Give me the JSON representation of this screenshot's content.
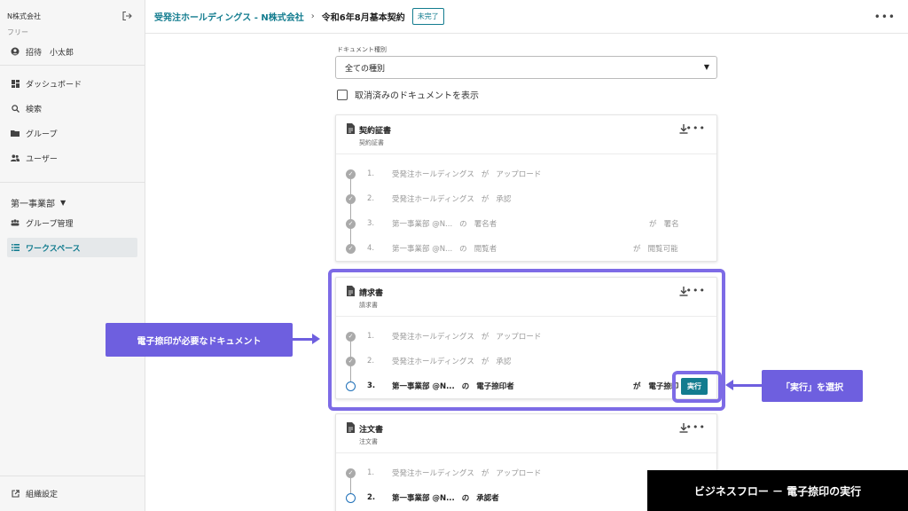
{
  "sidebar": {
    "org_name": "N株式会社",
    "plan": "フリー",
    "user": "招待　小太郎",
    "nav": [
      {
        "label": "ダッシュボード",
        "icon": "dashboard-icon"
      },
      {
        "label": "検索",
        "icon": "search-icon"
      },
      {
        "label": "グループ",
        "icon": "folder-icon"
      },
      {
        "label": "ユーザー",
        "icon": "users-icon"
      }
    ],
    "section": "第一事業部",
    "section_items": [
      {
        "label": "グループ管理",
        "icon": "group-icon"
      },
      {
        "label": "ワークスペース",
        "icon": "list-icon"
      }
    ],
    "settings": "組織設定"
  },
  "header": {
    "breadcrumb_link": "受発注ホールディングス - N株式会社",
    "breadcrumb_sep": "›",
    "current": "令和6年8月基本契約",
    "status": "未完了"
  },
  "filter": {
    "label": "ドキュメント種別",
    "value": "全ての種別",
    "checkbox_label": "取消済みのドキュメントを表示"
  },
  "cards": [
    {
      "title": "契約証書",
      "subtitle": "契約証書",
      "steps": [
        {
          "num": "1.",
          "actor": "受発注ホールディングス",
          "particle": "が",
          "action": "アップロード"
        },
        {
          "num": "2.",
          "actor": "受発注ホールディングス",
          "particle": "が",
          "action": "承認"
        },
        {
          "num": "3.",
          "actor": "第一事業部 @N...",
          "particle": "の",
          "action": "署名者",
          "rparticle": "が",
          "raction": "署名"
        },
        {
          "num": "4.",
          "actor": "第一事業部 @N...",
          "particle": "の",
          "action": "閲覧者",
          "rparticle": "が",
          "raction": "閲覧可能"
        }
      ]
    },
    {
      "title": "請求書",
      "subtitle": "請求書",
      "steps": [
        {
          "num": "1.",
          "actor": "受発注ホールディングス",
          "particle": "が",
          "action": "アップロード"
        },
        {
          "num": "2.",
          "actor": "受発注ホールディングス",
          "particle": "が",
          "action": "承認"
        },
        {
          "num": "3.",
          "actor": "第一事業部 @N...",
          "particle": "の",
          "action": "電子捺印者",
          "rparticle": "が",
          "raction": "電子捺印"
        }
      ],
      "exec_button": "実行"
    },
    {
      "title": "注文書",
      "subtitle": "注文書",
      "steps": [
        {
          "num": "1.",
          "actor": "受発注ホールディングス",
          "particle": "が",
          "action": "アップロード"
        },
        {
          "num": "2.",
          "actor": "第一事業部 @N...",
          "particle": "の",
          "action": "承認者"
        }
      ]
    }
  ],
  "callouts": {
    "left": "電子捺印が必要なドキュメント",
    "right": "「実行」を選択"
  },
  "banner": "ビジネスフロー － 電子捺印の実行",
  "colors": {
    "accent": "#137c8f",
    "highlight": "#7d6be6",
    "callout": "#6e5fdf"
  }
}
